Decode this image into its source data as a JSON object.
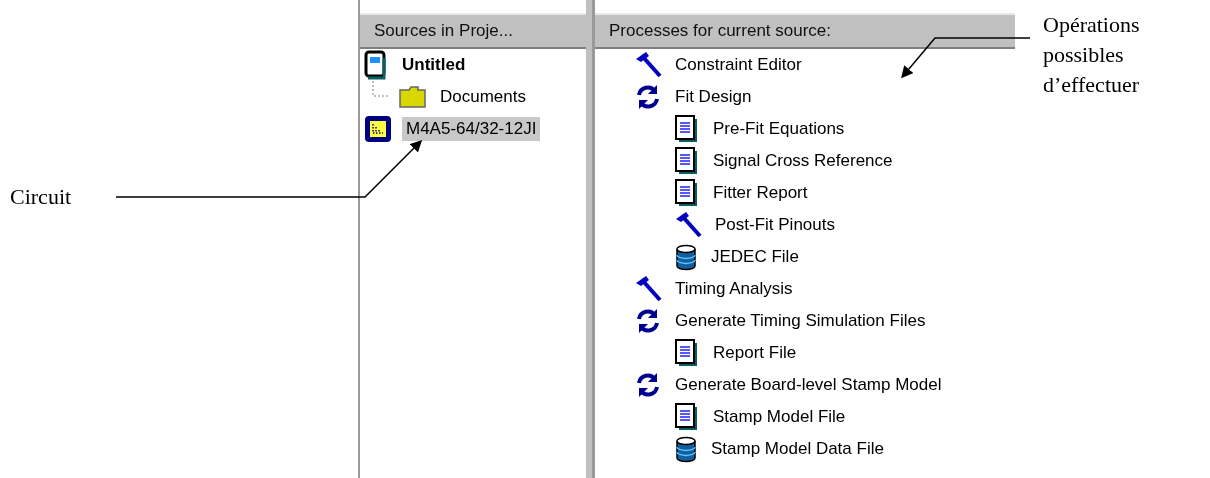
{
  "annotations": [
    {
      "kind": "left",
      "lines": [
        "Circuit"
      ]
    },
    {
      "kind": "right",
      "lines": [
        "Opérations",
        "possibles",
        "d’effectuer"
      ]
    }
  ],
  "sources_panel": {
    "header": "Sources in Proje...",
    "items": [
      {
        "kind": "project",
        "label": "Untitled",
        "selected": false,
        "children": [
          {
            "kind": "folder",
            "label": "Documents",
            "selected": false
          }
        ]
      },
      {
        "kind": "device",
        "label": "M4A5-64/32-12JI",
        "selected": true
      }
    ]
  },
  "processes_panel": {
    "header": "Processes for current source:",
    "items": [
      {
        "kind": "tool",
        "label": "Constraint Editor"
      },
      {
        "kind": "cycle",
        "label": "Fit Design",
        "children": [
          {
            "kind": "report",
            "label": "Pre-Fit Equations"
          },
          {
            "kind": "report",
            "label": "Signal Cross Reference"
          },
          {
            "kind": "report",
            "label": "Fitter Report"
          },
          {
            "kind": "tool",
            "label": "Post-Fit Pinouts"
          },
          {
            "kind": "data",
            "label": "JEDEC File"
          }
        ]
      },
      {
        "kind": "tool",
        "label": "Timing Analysis"
      },
      {
        "kind": "cycle",
        "label": "Generate Timing Simulation Files",
        "children": [
          {
            "kind": "report",
            "label": "Report File"
          }
        ]
      },
      {
        "kind": "cycle",
        "label": "Generate Board-level Stamp Model",
        "children": [
          {
            "kind": "report",
            "label": "Stamp Model File"
          },
          {
            "kind": "data",
            "label": "Stamp Model Data File"
          }
        ]
      }
    ]
  }
}
